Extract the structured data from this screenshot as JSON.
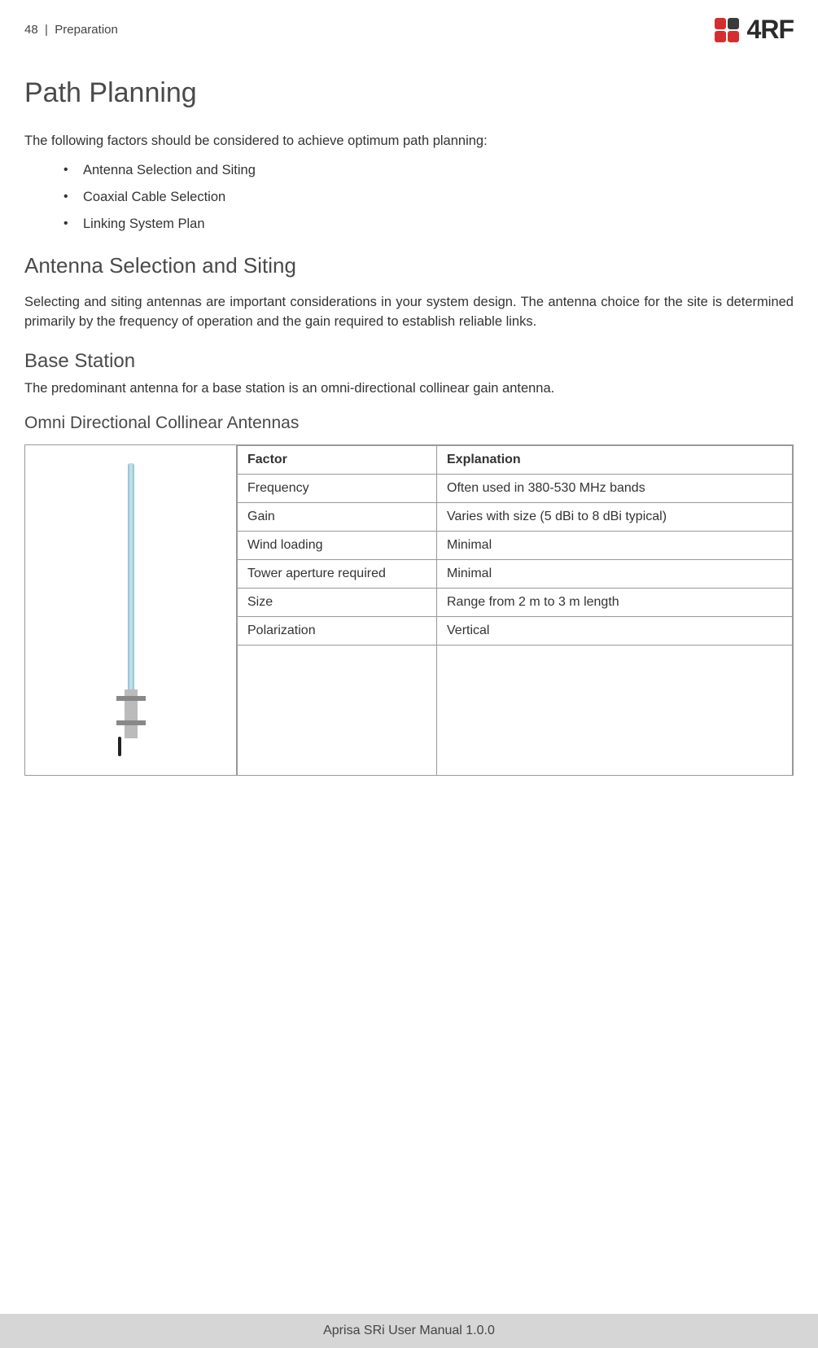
{
  "header": {
    "page_number": "48",
    "separator": "|",
    "section": "Preparation",
    "logo_text": "4RF"
  },
  "h1": "Path Planning",
  "intro": "The following factors should be considered to achieve optimum path planning:",
  "bullets": [
    "Antenna Selection and Siting",
    "Coaxial Cable Selection",
    "Linking System Plan"
  ],
  "h2": "Antenna Selection and Siting",
  "antenna_para": "Selecting and siting antennas are important considerations in your system design. The antenna choice for the site is determined primarily by the frequency of operation and the gain required to establish reliable links.",
  "h3": "Base Station",
  "base_station_para": "The predominant antenna for a base station is an omni-directional collinear gain antenna.",
  "h4": "Omni Directional Collinear Antennas",
  "table": {
    "headers": {
      "factor": "Factor",
      "explanation": "Explanation"
    },
    "rows": [
      {
        "factor": "Frequency",
        "explanation": "Often used in 380-530 MHz bands"
      },
      {
        "factor": "Gain",
        "explanation": "Varies with size (5 dBi to 8 dBi typical)"
      },
      {
        "factor": "Wind loading",
        "explanation": "Minimal"
      },
      {
        "factor": "Tower aperture required",
        "explanation": "Minimal"
      },
      {
        "factor": "Size",
        "explanation": "Range from 2 m to 3 m length"
      },
      {
        "factor": "Polarization",
        "explanation": "Vertical"
      }
    ]
  },
  "footer": "Aprisa SRi User Manual 1.0.0"
}
